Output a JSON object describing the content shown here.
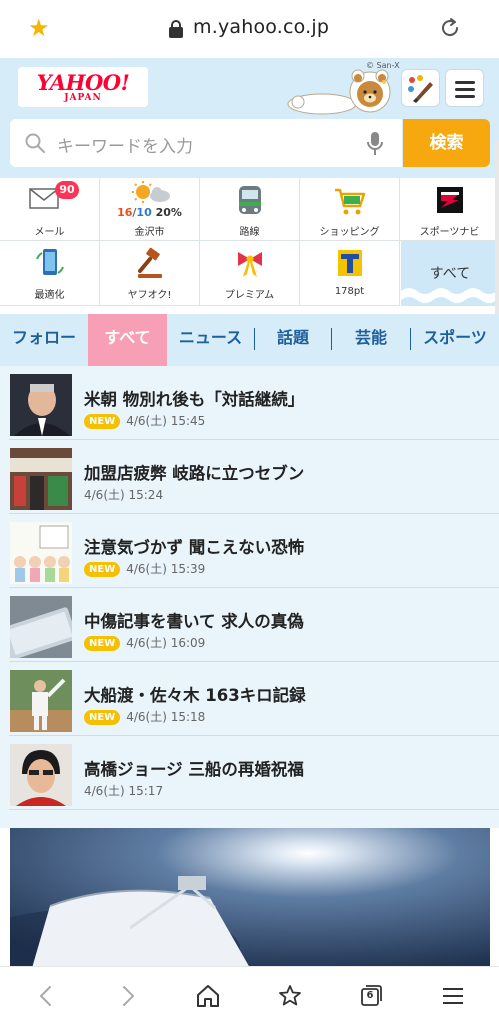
{
  "browser": {
    "url": "m.yahoo.co.jp",
    "tab_count": "6"
  },
  "header": {
    "logo_word": "YAHOO!",
    "logo_sub": "JAPAN",
    "copyright": "© San-X"
  },
  "search": {
    "placeholder": "キーワードを入力",
    "button_label": "検索"
  },
  "services": {
    "mail": {
      "label": "メール",
      "badge": "90"
    },
    "weather": {
      "label": "金沢市",
      "hi": "16",
      "sep": "/",
      "lo": "10",
      "pct": "20%"
    },
    "transit": {
      "label": "路線"
    },
    "shopping": {
      "label": "ショッピング"
    },
    "sportsnavi": {
      "label": "スポーツナビ"
    },
    "optimize": {
      "label": "最適化"
    },
    "auction": {
      "label": "ヤフオク!"
    },
    "premium": {
      "label": "プレミアム"
    },
    "tpoint": {
      "label": "178pt"
    },
    "all": {
      "label": "すべて"
    }
  },
  "tabs": {
    "follow": "フォロー",
    "all": "すべて",
    "news": "ニュース",
    "topics": "話題",
    "entertainment": "芸能",
    "sports": "スポーツ"
  },
  "news": [
    {
      "title": "米朝 物別れ後も「対話継続」",
      "new": "NEW",
      "time": "4/6(土) 15:45"
    },
    {
      "title": "加盟店疲弊 岐路に立つセブン",
      "new": "",
      "time": "4/6(土) 15:24"
    },
    {
      "title": "注意気づかず 聞こえない恐怖",
      "new": "NEW",
      "time": "4/6(土) 15:39"
    },
    {
      "title": "中傷記事を書いて 求人の真偽",
      "new": "NEW",
      "time": "4/6(土) 16:09"
    },
    {
      "title": "大船渡・佐々木 163キロ記録",
      "new": "NEW",
      "time": "4/6(土) 15:18"
    },
    {
      "title": "高橋ジョージ 三船の再婚祝福",
      "new": "",
      "time": "4/6(土) 15:17"
    }
  ],
  "colors": {
    "header_bg": "#d6ecf9",
    "search_button": "#f8a80f",
    "tab_active": "#f79fb4",
    "new_badge": "#f5c000",
    "logo_red": "#ff0033"
  }
}
